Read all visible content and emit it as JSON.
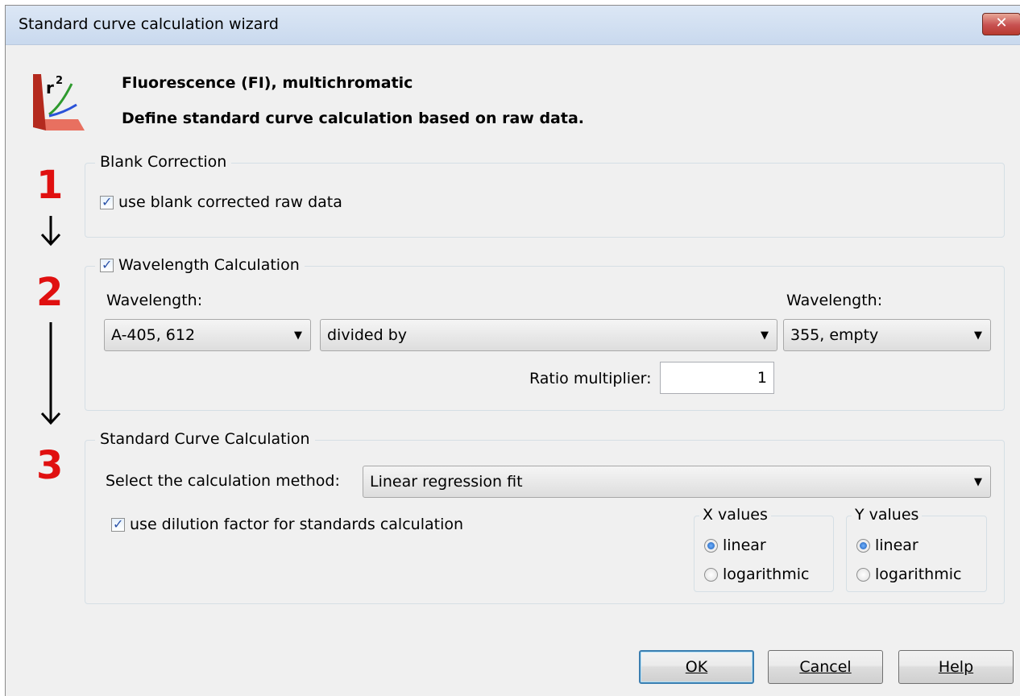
{
  "window": {
    "title": "Standard curve calculation wizard",
    "close_label": "✕"
  },
  "header": {
    "line1": "Fluorescence (FI), multichromatic",
    "line2": "Define standard curve calculation based on raw data.",
    "logo_icon": "r-squared-chart-icon"
  },
  "steps": [
    "1",
    "2",
    "3"
  ],
  "blank_correction": {
    "legend": "Blank Correction",
    "use_blank_label": "use blank corrected raw data",
    "use_blank_checked": true
  },
  "wavelength_calc": {
    "legend": "Wavelength Calculation",
    "enabled": true,
    "left_label": "Wavelength:",
    "left_value": "A-405, 612",
    "operator_value": "divided by",
    "right_label": "Wavelength:",
    "right_value": "355, empty",
    "ratio_label": "Ratio multiplier:",
    "ratio_value": "1"
  },
  "std_curve": {
    "legend": "Standard Curve Calculation",
    "method_label": "Select the calculation method:",
    "method_value": "Linear regression fit",
    "dilution_label": "use dilution factor for standards calculation",
    "dilution_checked": true,
    "x_values": {
      "legend": "X values",
      "options": [
        "linear",
        "logarithmic"
      ],
      "selected": "linear"
    },
    "y_values": {
      "legend": "Y values",
      "options": [
        "linear",
        "logarithmic"
      ],
      "selected": "linear"
    }
  },
  "buttons": {
    "ok_label": "OK",
    "cancel_label": "Cancel",
    "help_label": "Help"
  },
  "colors": {
    "step_number": "#e01010",
    "accent": "#2a52a8"
  }
}
